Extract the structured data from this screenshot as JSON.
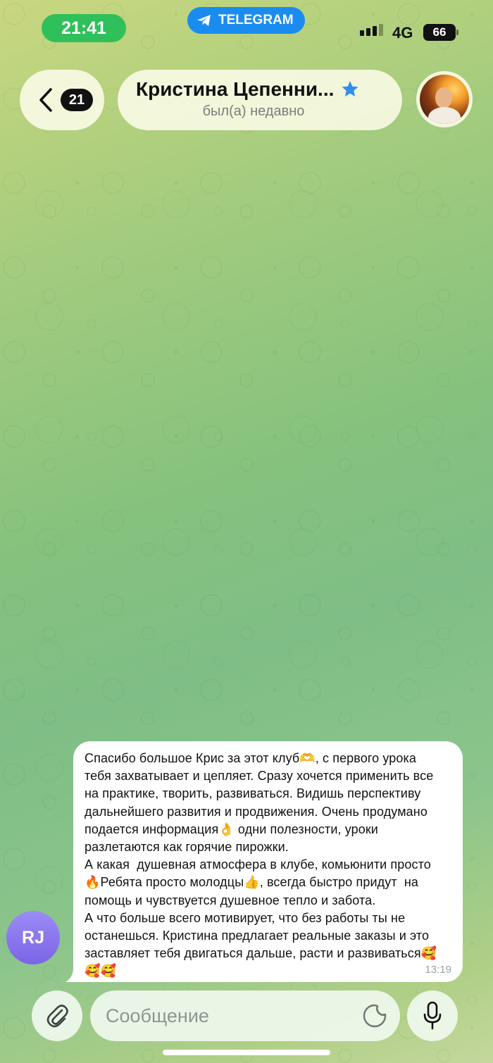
{
  "status_bar": {
    "time": "21:41",
    "app_pill": "TELEGRAM",
    "network": "4G",
    "battery": "66",
    "signal_bars_active": 3,
    "signal_bars_total": 4
  },
  "header": {
    "back_count": "21",
    "chat_title": "Кристина Цепенни...",
    "subtitle": "был(а) недавно",
    "star_icon": "star-icon",
    "back_icon": "chevron-left-icon"
  },
  "message": {
    "avatar_initials": "RJ",
    "text": "Спасибо большое Крис за этот клуб🫶, с первого урока\nтебя захватывает и цепляет. Сразу хочется применить все\nна практике, творить, развиваться. Видишь перспективу\nдальнейшего развития и продвижения. Очень продумано\nподается информация👌 одни полезности, уроки\nразлетаются как горячие пирожки.\nА какая  душевная атмосфера в клубе, комьюнити просто\n🔥Ребята просто молодцы👍, всегда быстро придут  на\nпомощь и чувствуется душевное тепло и забота.\nА что больше всего мотивирует, что без работы ты не\nостанешься. Кристина предлагает реальные заказы и это\nзаставляет тебя двигаться дальше, расти и развиваться🥰\n🥰🥰",
    "time": "13:19"
  },
  "composer": {
    "placeholder": "Сообщение",
    "attach_icon": "paperclip-icon",
    "sticker_icon": "sticker-icon",
    "mic_icon": "microphone-icon"
  },
  "colors": {
    "time_pill": "#2fc05b",
    "telegram_pill": "#1a8cf0",
    "avatar_gradient_top": "#9b8cf5",
    "avatar_gradient_bottom": "#7b64e6",
    "star": "#2f8ef0"
  }
}
